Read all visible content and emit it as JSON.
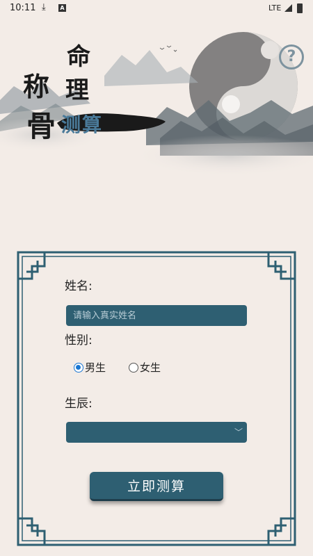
{
  "status_bar": {
    "time": "10:11",
    "network": "LTE"
  },
  "banner": {
    "title_ming": "命",
    "title_li": "理",
    "title_cheng": "称",
    "title_gu": "骨",
    "title_cesuan": "测算",
    "help": "?"
  },
  "form": {
    "name_label": "姓名:",
    "name_placeholder": "请输入真实姓名",
    "gender_label": "性别:",
    "gender_options": [
      {
        "label": "男生",
        "selected": true
      },
      {
        "label": "女生",
        "selected": false
      }
    ],
    "birth_label": "生辰:",
    "birth_value": "",
    "submit_label": "立即测算"
  },
  "colors": {
    "accent": "#2e5f72",
    "background": "#f3ece7",
    "radio_selected": "#1976d2"
  }
}
